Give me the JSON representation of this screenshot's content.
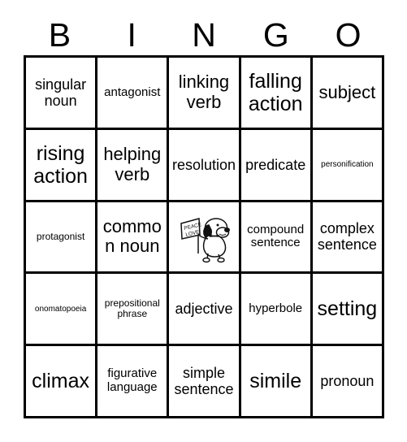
{
  "card": {
    "title": "BINGO",
    "header_letters": [
      "B",
      "I",
      "N",
      "G",
      "O"
    ],
    "grid_size": "5x5",
    "border_color": "#000000",
    "background_color": "#ffffff",
    "text_color": "#000000"
  },
  "rows": [
    {
      "cells": [
        {
          "text": "singular noun",
          "size": "md"
        },
        {
          "text": "antagonist",
          "size": "sm"
        },
        {
          "text": "linking verb",
          "size": "lg"
        },
        {
          "text": "falling action",
          "size": "xl"
        },
        {
          "text": "subject",
          "size": "lg"
        }
      ]
    },
    {
      "cells": [
        {
          "text": "rising action",
          "size": "xl"
        },
        {
          "text": "helping verb",
          "size": "lg"
        },
        {
          "text": "resolution",
          "size": "md"
        },
        {
          "text": "predicate",
          "size": "md"
        },
        {
          "text": "personification",
          "size": "xxs"
        }
      ]
    },
    {
      "cells": [
        {
          "text": "protagonist",
          "size": "xs"
        },
        {
          "text": "common noun",
          "size": "lg"
        },
        {
          "text": "",
          "size": "md",
          "free_space": true,
          "image": "snoopy-peace-love-flag",
          "image_caption": "PEACE LOVE"
        },
        {
          "text": "compound sentence",
          "size": "sm"
        },
        {
          "text": "complex sentence",
          "size": "md"
        }
      ]
    },
    {
      "cells": [
        {
          "text": "onomatopoeia",
          "size": "xxs"
        },
        {
          "text": "prepositional phrase",
          "size": "xs"
        },
        {
          "text": "adjective",
          "size": "md"
        },
        {
          "text": "hyperbole",
          "size": "sm"
        },
        {
          "text": "setting",
          "size": "xl"
        }
      ]
    },
    {
      "cells": [
        {
          "text": "climax",
          "size": "xl"
        },
        {
          "text": "figurative language",
          "size": "sm"
        },
        {
          "text": "simple sentence",
          "size": "md"
        },
        {
          "text": "simile",
          "size": "xl"
        },
        {
          "text": "pronoun",
          "size": "md"
        }
      ]
    }
  ],
  "free_space": {
    "flag_line_1": "PEACE",
    "flag_line_2": "LOVE"
  }
}
